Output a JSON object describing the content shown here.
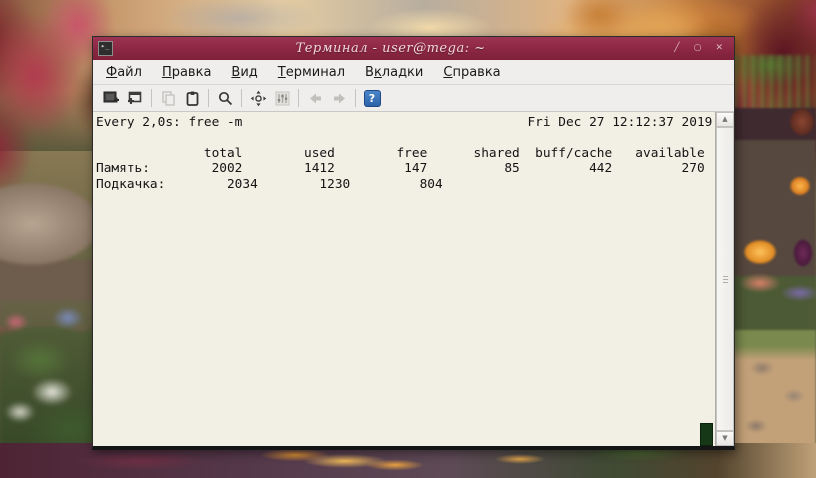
{
  "window": {
    "title": "Терминал - user@mega: ~",
    "controls": {
      "minimize": "╱",
      "maximize": "○",
      "close": "✕"
    },
    "colors": {
      "titlebar": "#8e2946",
      "menubar_bg": "#efeeec",
      "terminal_bg": "#f2f0e4",
      "terminal_text": "#141414",
      "cursor_green": "#163816",
      "help_button_blue": "#2d62a8"
    }
  },
  "menu": {
    "items": [
      {
        "pre": "",
        "key": "Ф",
        "post": "айл"
      },
      {
        "pre": "",
        "key": "П",
        "post": "равка"
      },
      {
        "pre": "",
        "key": "В",
        "post": "ид"
      },
      {
        "pre": "",
        "key": "Т",
        "post": "ерминал"
      },
      {
        "pre": "В",
        "key": "к",
        "post": "ладки"
      },
      {
        "pre": "",
        "key": "С",
        "post": "правка"
      }
    ]
  },
  "toolbar": {
    "icons": [
      {
        "name": "open-terminal",
        "enabled": true
      },
      {
        "name": "open-tab",
        "enabled": true
      },
      {
        "name": "copy",
        "enabled": false
      },
      {
        "name": "paste",
        "enabled": true
      },
      {
        "name": "search",
        "enabled": true
      },
      {
        "name": "fullscreen",
        "enabled": true
      },
      {
        "name": "preferences",
        "enabled": false
      },
      {
        "name": "back",
        "enabled": false
      },
      {
        "name": "forward",
        "enabled": false
      },
      {
        "name": "help",
        "enabled": true
      }
    ],
    "help_glyph": "?"
  },
  "scrollbar": {
    "up_glyph": "▲",
    "down_glyph": "▼"
  },
  "terminal": {
    "watch_command": "Every 2,0s: free -m",
    "timestamp": "Fri Dec 27 12:12:37 2019",
    "lines": [
      "Every 2,0s: free -m                                     Fri Dec 27 12:12:37 2019",
      "",
      "              total        used        free      shared  buff/cache   available",
      "Память:        2002        1412         147          85         442         270",
      "Подкачка:        2034        1230         804"
    ],
    "free_table": {
      "headers": [
        "total",
        "used",
        "free",
        "shared",
        "buff/cache",
        "available"
      ],
      "rows": [
        {
          "label": "Память:",
          "values": [
            2002,
            1412,
            147,
            85,
            442,
            270
          ]
        },
        {
          "label": "Подкачка:",
          "values": [
            2034,
            1230,
            804
          ]
        }
      ]
    }
  }
}
